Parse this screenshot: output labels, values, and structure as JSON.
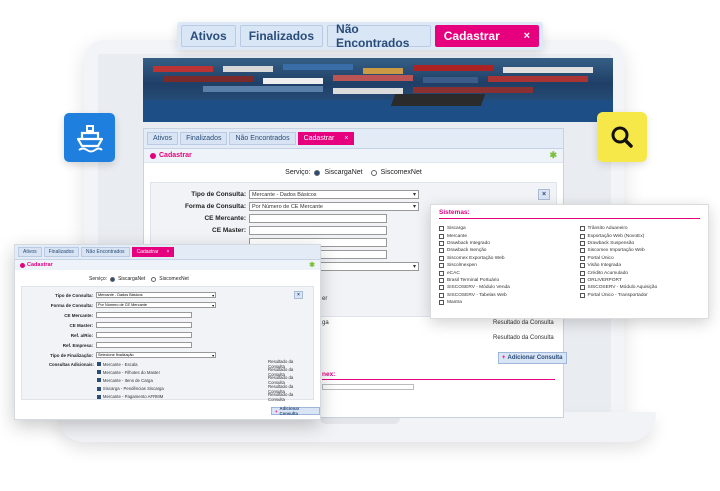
{
  "tabs": {
    "ativos": "Ativos",
    "finalizados": "Finalizados",
    "nao_encontrados": "Não Encontrados",
    "cadastrar": "Cadastrar",
    "close": "×"
  },
  "form": {
    "title": "Cadastrar",
    "servico_label": "Serviço:",
    "servico_options": [
      "SiscargaNet",
      "SiscomexNet"
    ],
    "tipo_consulta_label": "Tipo de Consulta:",
    "tipo_consulta_value": "Mercante - Dados Básicos",
    "forma_consulta_label": "Forma de Consulta:",
    "forma_consulta_value": "Por Número de CE Mercante",
    "ce_mercante_label": "CE Mercante:",
    "ce_master_label": "CE Master:",
    "ref_ag_label": "Ref. a/Rio:",
    "ref_empresa_label": "Ref. Empresa:",
    "tipo_finalizacao_label": "Tipo de Finalização:",
    "tipo_finalizacao_value": "Selecione finalização",
    "consultas_label": "Consultas Adicionais:",
    "consultas": [
      "Mercante - Escala",
      "Mercante - Filhotes do Master",
      "Mercante - Itens de Carga",
      "Siscarga - Pendências Siscarga",
      "Mercante - Pagamento AFRMM"
    ],
    "resultado": "Resultado da Consulta",
    "add_consulta": "Adicionar Consulta",
    "add_consulta_small": "Adicionar Consulta",
    "x": "×"
  },
  "mid_partial": {
    "r1": "er",
    "r2": "ga",
    "r3": "nex:"
  },
  "sistemas": {
    "title": "Sistemas:",
    "col1": [
      "Siscarga",
      "Mercante",
      "Drawback Integrado",
      "Drawback Isenção",
      "Siscomex Exportação Web",
      "Siscolmexpen",
      "eCAC",
      "Brasil Terminal Portuário",
      "SISCOSERV - Módulo Venda",
      "SISCOSERV - Tabelas Web",
      "Mantra"
    ],
    "col2": [
      "Trânsito Aduaneiro",
      "Exportação Web (NovoEx)",
      "Drawback Suspensão",
      "Siscomex Importação Web",
      "Portal Único",
      "Visão Integrada",
      "Crédito Acumulado",
      "ORLIVERPORT",
      "SISCOSERV - Módulo Aquisição",
      "Portal Único - Transportador"
    ]
  },
  "colors": {
    "accent": "#e6007e",
    "primary": "#2a4c78",
    "ship_tile": "#1e7fde",
    "search_tile": "#f7e84a"
  },
  "icons": [
    "ship-icon",
    "search-icon",
    "plus-icon",
    "close-icon"
  ]
}
